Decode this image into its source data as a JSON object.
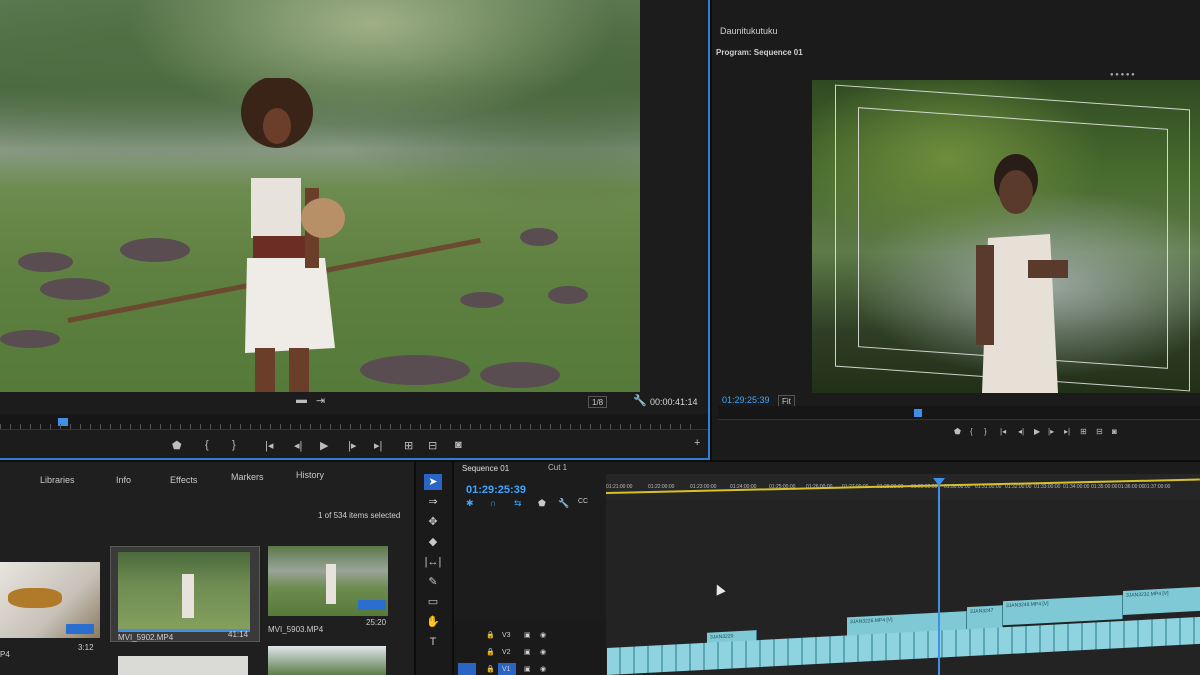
{
  "source_monitor": {
    "zoom": "1/8",
    "timecode": "00:00:41:14",
    "plus": "+"
  },
  "window": {
    "title": "Daunitukutuku",
    "program_tab": "Program: Sequence 01"
  },
  "program_monitor": {
    "timecode": "01:29:25:39",
    "fit": "Fit"
  },
  "project_panel": {
    "tabs": [
      "Libraries",
      "Info",
      "Effects",
      "Markers",
      "History"
    ],
    "items_selected": "1 of 534 items selected",
    "clips": [
      {
        "name": "",
        "duration": "3:12"
      },
      {
        "name": "MVI_5902.MP4",
        "duration": "41:14"
      },
      {
        "name": "MVI_5903.MP4",
        "duration": "25:20"
      }
    ],
    "partial_label": "P4"
  },
  "timeline": {
    "sequence_tab": "Sequence 01",
    "cut_tab": "Cut 1",
    "timecode": "01:29:25:39",
    "ruler": [
      "01:21:00:00",
      "01:22:00:00",
      "01:23:00:00",
      "01:24:00:00",
      "01:25:00:00",
      "01:26:00:00",
      "01:27:00:00",
      "01:28:00:00",
      "01:29:00:00",
      "01:30:00:00",
      "01:31:00:00",
      "01:32:00:00",
      "01:33:00:00",
      "01:34:00:00",
      "01:35:00:00",
      "01:36:00:00",
      "01:37:00:00",
      "01:38:00:00"
    ],
    "tracks": [
      "V3",
      "V2",
      "V1"
    ],
    "clip_labels": [
      "3JAN3220",
      "3JAN3226.MP4 [V]",
      "3JAN3247",
      "3JAN3248.MP4 [V]",
      "3JAN3232.MP4 [V]"
    ]
  },
  "colors": {
    "accent_blue": "#3ea6ff",
    "panel_border": "#2f7fd8",
    "in_out_bar": "#d6c228",
    "clip_fill": "#7fc9d6"
  }
}
